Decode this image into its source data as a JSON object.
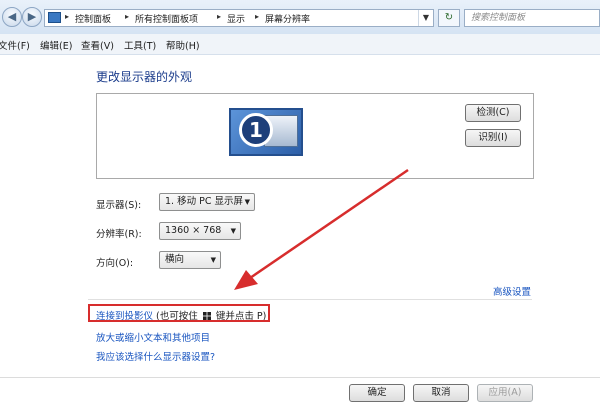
{
  "address_bar": {
    "breadcrumbs": [
      "控制面板",
      "所有控制面板项",
      "显示",
      "屏幕分辨率"
    ],
    "search_placeholder": "搜索控制面板"
  },
  "menu": [
    "文件(F)",
    "编辑(E)",
    "查看(V)",
    "工具(T)",
    "帮助(H)"
  ],
  "page": {
    "title": "更改显示器的外观",
    "monitor_number": "1",
    "detect_button": "检测(C)",
    "identify_button": "识别(I)"
  },
  "settings": {
    "display_label": "显示器(S):",
    "display_value": "1. 移动 PC 显示屏",
    "resolution_label": "分辨率(R):",
    "resolution_value": "1360 × 768",
    "orientation_label": "方向(O):",
    "orientation_value": "横向"
  },
  "links": {
    "advanced": "高级设置",
    "projector": "连接到投影仪",
    "projector_hint_pre": "(也可按住",
    "projector_hint_post": "键并点击 P)",
    "text_size": "放大或缩小文本和其他项目",
    "which_setting": "我应该选择什么显示器设置?"
  },
  "buttons": {
    "ok": "确定",
    "cancel": "取消",
    "apply": "应用(A)"
  },
  "colors": {
    "annotation": "#d72d2d",
    "link": "#1a56c0",
    "title": "#1c3d8c"
  }
}
